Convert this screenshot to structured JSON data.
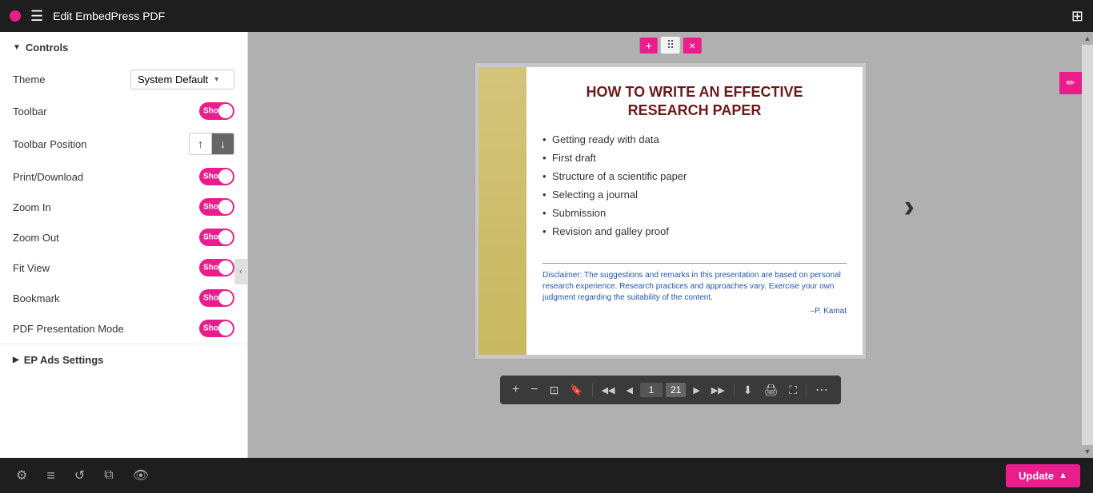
{
  "topbar": {
    "title": "Edit EmbedPress PDF",
    "menu_icon": "≡",
    "grid_icon": "⊞"
  },
  "controls": {
    "section_label": "Controls",
    "theme": {
      "label": "Theme",
      "value": "System Default"
    },
    "toolbar": {
      "label": "Toolbar",
      "toggle_label": "Show"
    },
    "toolbar_position": {
      "label": "Toolbar Position",
      "up_label": "↑",
      "down_label": "↓"
    },
    "print_download": {
      "label": "Print/Download",
      "toggle_label": "Show"
    },
    "zoom_in": {
      "label": "Zoom In",
      "toggle_label": "Show"
    },
    "zoom_out": {
      "label": "Zoom Out",
      "toggle_label": "Show"
    },
    "fit_view": {
      "label": "Fit View",
      "toggle_label": "Show"
    },
    "bookmark": {
      "label": "Bookmark",
      "toggle_label": "Show"
    },
    "pdf_presentation_mode": {
      "label": "PDF Presentation Mode",
      "toggle_label": "Show"
    }
  },
  "ads_settings": {
    "label": "EP Ads Settings"
  },
  "pdf": {
    "title_line1": "HOW TO WRITE AN EFFECTIVE",
    "title_line2": "RESEARCH PAPER",
    "bullets": [
      "Getting ready with data",
      "First draft",
      "Structure of a scientific paper",
      "Selecting a journal",
      "Submission",
      "Revision and galley proof"
    ],
    "disclaimer": "Disclaimer: The suggestions and remarks in this presentation are based on personal research experience. Research practices and approaches vary. Exercise your own judgment regarding the suitability of the content.",
    "author": "–P. Kamat",
    "page_current": "1",
    "page_total": "21"
  },
  "toolbar_icons": {
    "zoom_in": "+",
    "zoom_out": "−",
    "fit": "⊡",
    "bookmark": "🔖",
    "prev_prev": "◀◀",
    "prev": "◀",
    "next": "▶",
    "next_next": "▶▶",
    "download": "⬇",
    "print": "🖨",
    "fullscreen": "⛶",
    "more": "⋯"
  },
  "bottom_bar": {
    "settings_icon": "⚙",
    "layers_icon": "≡",
    "history_icon": "↺",
    "responsive_icon": "⧉",
    "visibility_icon": "👁",
    "update_label": "Update",
    "chevron_icon": "▲"
  },
  "block_toolbar": {
    "plus": "+",
    "drag": "⠿",
    "close": "×"
  },
  "colors": {
    "accent": "#e91e8c",
    "dark": "#1e1e1e",
    "toggle_bg": "#e91e8c"
  }
}
